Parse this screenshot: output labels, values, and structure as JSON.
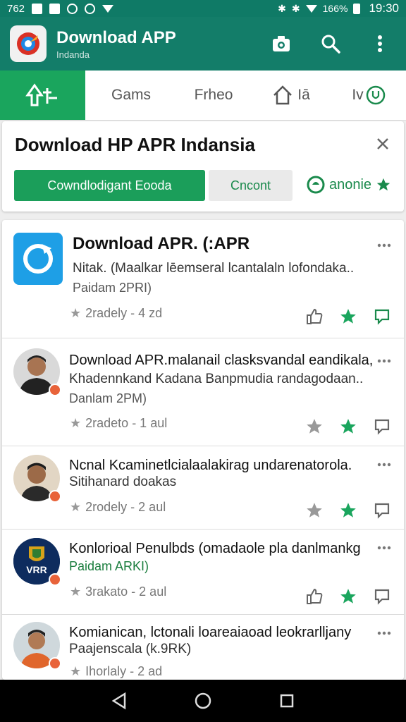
{
  "status_bar": {
    "left_text": "762",
    "battery_text": "166%",
    "time": "19:30"
  },
  "app_bar": {
    "title": "Download APP",
    "subtitle": "Indanda"
  },
  "tabs": [
    {
      "label": "",
      "icon": "share-icon"
    },
    {
      "label": "Gams"
    },
    {
      "label": "Frheo"
    },
    {
      "label": "Iā",
      "icon": "home-icon"
    },
    {
      "label": "Iv"
    }
  ],
  "banner": {
    "title": "Download HP APR Indansia",
    "primary_label": "Cowndlodigant Eooda",
    "secondary_label": "Cncont",
    "link_label": "anonie"
  },
  "feed": [
    {
      "title": "Download APR. (:APR",
      "line1": "Nitak. (Maalkar lēemseral lcantalaln lofondaka..",
      "sub": "Paidam 2PRI)",
      "meta": "2radely - 4 zd"
    },
    {
      "title": "Download APR.malanail clasksvandal eandikala,",
      "line1": "Khadennkand Kadana Banpmudia randagodaan..",
      "sub": "Danlam 2PM)",
      "meta": "2radeto - 1 aul"
    },
    {
      "title": "Ncnal Kcaminetlcialaalakirag undarenatorola.",
      "line1": "Sitihanard doakas",
      "sub": "",
      "meta": "2rodely - 2 aul"
    },
    {
      "title": "Konlorioal Penulbds (omadaole pla danlmankg",
      "line1": "",
      "sub": "Paidam ARKI)",
      "meta": "3rakato - 2 aul",
      "avatar_text": "VRR"
    },
    {
      "title": "Komianican, lctonali loareaiaoad leokrarlljany",
      "line1": "Paajenscala (k.9RK)",
      "sub": "",
      "meta": "Ihorlaly - 2 ad"
    }
  ],
  "colors": {
    "primary": "#137d69",
    "accent": "#1aa55d",
    "status": "#0f7a66"
  }
}
